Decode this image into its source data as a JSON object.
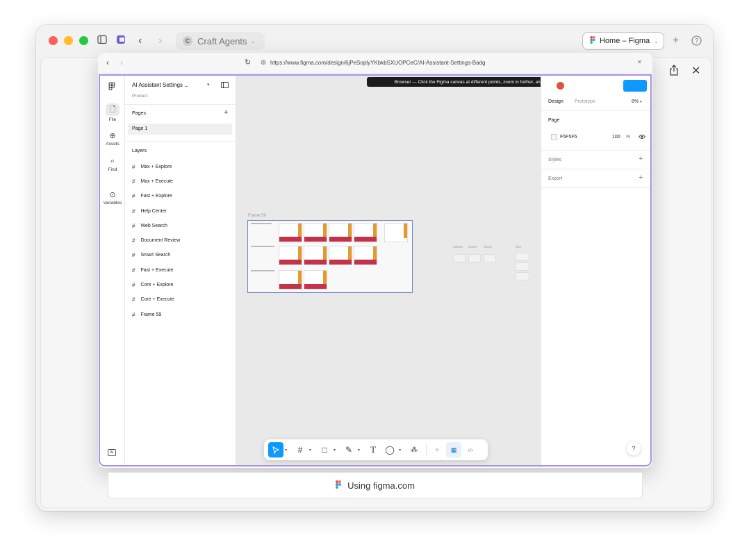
{
  "outer": {
    "craft_tab": {
      "letter": "C",
      "label": "Craft Agents"
    },
    "home_tab": {
      "label": "Home – Figma"
    },
    "icons": {
      "sidebar": "sidebar-toggle-icon",
      "app": "craft-logo-icon",
      "back": "chevron-left-icon",
      "forward": "chevron-right-icon",
      "plus": "plus-icon",
      "help": "help-icon",
      "share": "share-icon",
      "close": "close-icon"
    }
  },
  "browser": {
    "url": "https://www.figma.com/design/6jPeSoplyYKbkbSXUOPCeC/AI-Assistant-Settings-Badg"
  },
  "tooltip": "Browser — Click the Figma canvas at different points, zoom in further, and pan slightly to move around the design.",
  "figma": {
    "strip": [
      {
        "label": "File"
      },
      {
        "label": "Assets"
      },
      {
        "label": "Find"
      },
      {
        "label": "Variables"
      }
    ],
    "file_title": "AI Assistant Settings ...",
    "file_subtitle": "Product",
    "pages_heading": "Pages",
    "pages": [
      "Page 1"
    ],
    "layers_heading": "Layers",
    "layers": [
      "Max + Explore",
      "Max + Execute",
      "Fast + Explore",
      "Help Center",
      "Web Search",
      "Document Review",
      "Smart Search",
      "Fast + Execute",
      "Core + Explore",
      "Core + Execute",
      "Frame 59"
    ],
    "frame_label": "Frame 59",
    "right": {
      "tab_design": "Design",
      "tab_prototype": "Prototype",
      "zoom": "8%",
      "page_heading": "Page",
      "bg_color": "F5F5F5",
      "opacity": "100",
      "opacity_unit": "%",
      "styles": "Styles",
      "export": "Export"
    },
    "help": "?",
    "ai_badge": "AI"
  },
  "using_bar": "Using figma.com",
  "colors": {
    "red": "#ff5f57",
    "yellow": "#febc2e",
    "green": "#28c840",
    "accent": "#0d99ff",
    "purple_border": "#a98fe8"
  }
}
